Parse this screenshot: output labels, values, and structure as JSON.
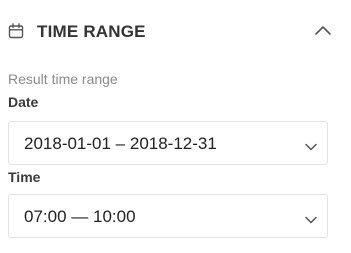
{
  "panel": {
    "title": "TIME RANGE",
    "icon": "calendar-icon",
    "toggle_icon": "chevron-up-icon"
  },
  "subtitle": "Result time range",
  "fields": {
    "date": {
      "label": "Date",
      "value": "2018-01-01 – 2018-12-31",
      "icon": "chevron-down-icon"
    },
    "time": {
      "label": "Time",
      "value": "07:00 — 10:00",
      "icon": "chevron-down-icon"
    }
  },
  "colors": {
    "text": "#333333",
    "muted": "#8a8a8a",
    "border": "#e3e3e3",
    "icon": "#555555"
  }
}
